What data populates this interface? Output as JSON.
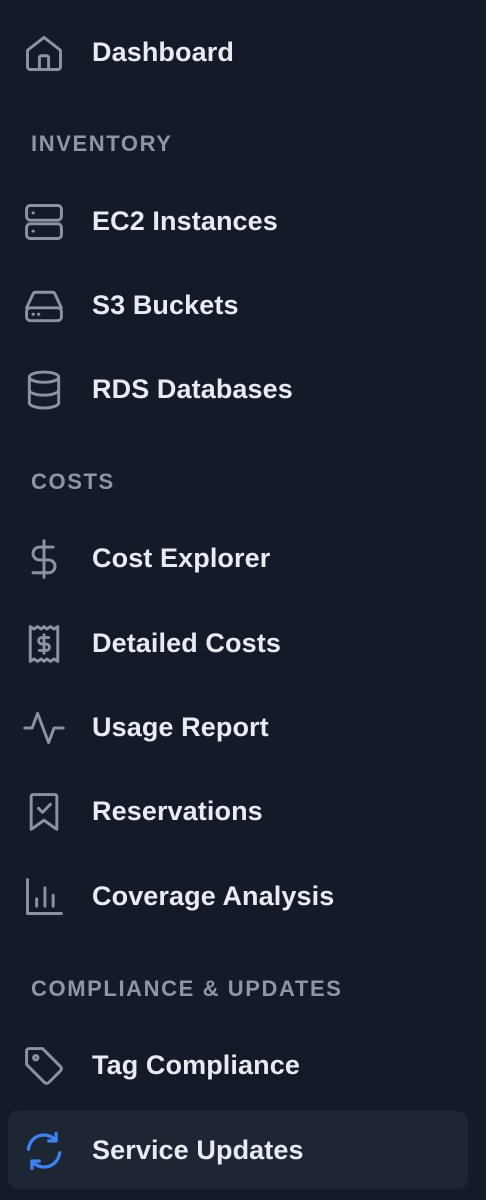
{
  "nav": {
    "dashboard": {
      "label": "Dashboard",
      "icon": "home-icon"
    },
    "sections": {
      "inventory": "INVENTORY",
      "costs": "COSTS",
      "compliance": "COMPLIANCE & UPDATES"
    },
    "inventory_items": [
      {
        "label": "EC2 Instances",
        "icon": "server-icon"
      },
      {
        "label": "S3 Buckets",
        "icon": "hard-drive-icon"
      },
      {
        "label": "RDS Databases",
        "icon": "database-icon"
      }
    ],
    "cost_items": [
      {
        "label": "Cost Explorer",
        "icon": "dollar-sign-icon"
      },
      {
        "label": "Detailed Costs",
        "icon": "receipt-icon"
      },
      {
        "label": "Usage Report",
        "icon": "activity-icon"
      },
      {
        "label": "Reservations",
        "icon": "bookmark-check-icon"
      },
      {
        "label": "Coverage Analysis",
        "icon": "bar-chart-icon"
      }
    ],
    "compliance_items": [
      {
        "label": "Tag Compliance",
        "icon": "tag-icon"
      },
      {
        "label": "Service Updates",
        "icon": "refresh-icon",
        "active": true
      }
    ]
  },
  "colors": {
    "background": "#141a28",
    "active_background": "#1f2633",
    "icon_default": "#8b92a0",
    "icon_active": "#3b82f6",
    "section_label": "#8e95a3",
    "item_label": "#e8ebf1"
  }
}
